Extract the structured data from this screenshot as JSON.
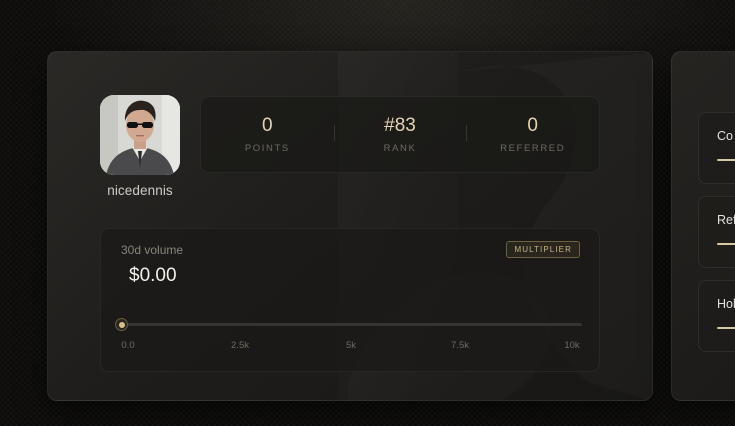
{
  "profile": {
    "username": "nicedennis"
  },
  "stats": [
    {
      "value": "0",
      "label": "POINTS"
    },
    {
      "value": "#83",
      "label": "RANK"
    },
    {
      "value": "0",
      "label": "REFERRED"
    }
  ],
  "volume": {
    "label": "30d volume",
    "amount": "$0.00",
    "badge": "MULTIPLIER",
    "slider_value": 0,
    "slider_max": 10000,
    "ticks": [
      "0.0",
      "2.5k",
      "5k",
      "7.5k",
      "10k"
    ]
  },
  "side_panel": {
    "items": [
      {
        "label": "Co"
      },
      {
        "label": "Ref"
      },
      {
        "label": "Hol"
      }
    ]
  },
  "colors": {
    "accent": "#d7c08b",
    "stat_value": "#e3d5b4",
    "background": "#0d0c0b"
  }
}
